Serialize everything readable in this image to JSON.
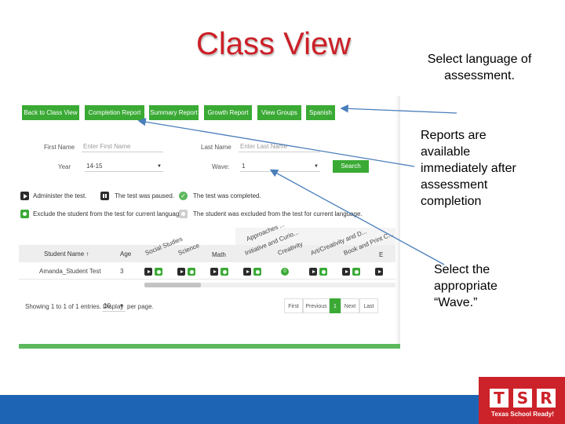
{
  "slide": {
    "title": "Class View",
    "callouts": {
      "language": "Select language of assessment.",
      "reports": "Reports are available immediately after assessment completion",
      "wave": "Select the appropriate “Wave.”"
    }
  },
  "toolbar": {
    "buttons": [
      "Back to Class View",
      "Completion Report",
      "Summary Report",
      "Growth Report",
      "View Groups",
      "Spanish"
    ]
  },
  "filters": {
    "first_name_label": "First Name",
    "first_name_placeholder": "Enter First Name",
    "last_name_label": "Last Name",
    "last_name_placeholder": "Enter Last Name",
    "year_label": "Year",
    "year_value": "14-15",
    "wave_label": "Wave:",
    "wave_value": "1",
    "search_label": "Search"
  },
  "legend": {
    "administer": "Administer the test.",
    "paused": "The test was paused.",
    "completed": "The test was completed.",
    "exclude": "Exclude the student from the test for current language.",
    "excluded": "The student was excluded from the test for current language."
  },
  "table": {
    "student_name_header": "Student Name",
    "sort_arrow": "↑",
    "age_header": "Age",
    "domains": [
      "Social Studies",
      "Science",
      "Math",
      "Initiative and Curio...",
      "Approaches ...",
      "Creativity",
      "Art/Creativity and D...",
      "Book and Print C...",
      "E"
    ],
    "row": {
      "name": "Amanda_Student Test",
      "age": "3",
      "zero_badge": "0"
    }
  },
  "pagination": {
    "showing": "Showing 1 to 1 of 1 entries. Display",
    "per_page_value": "10",
    "per_page_suffix": "per page.",
    "first": "First",
    "previous": "Previous",
    "current": "1",
    "next": "Next",
    "last": "Last"
  },
  "logo": {
    "letters": [
      "T",
      "S",
      "R"
    ],
    "tagline": "Texas School Ready!"
  },
  "colors": {
    "title_red": "#cc1f26",
    "button_green": "#3aaa35",
    "footer_blue": "#1e64b4",
    "logo_red": "#cc2229",
    "arrow_blue": "#4a7ebb"
  }
}
